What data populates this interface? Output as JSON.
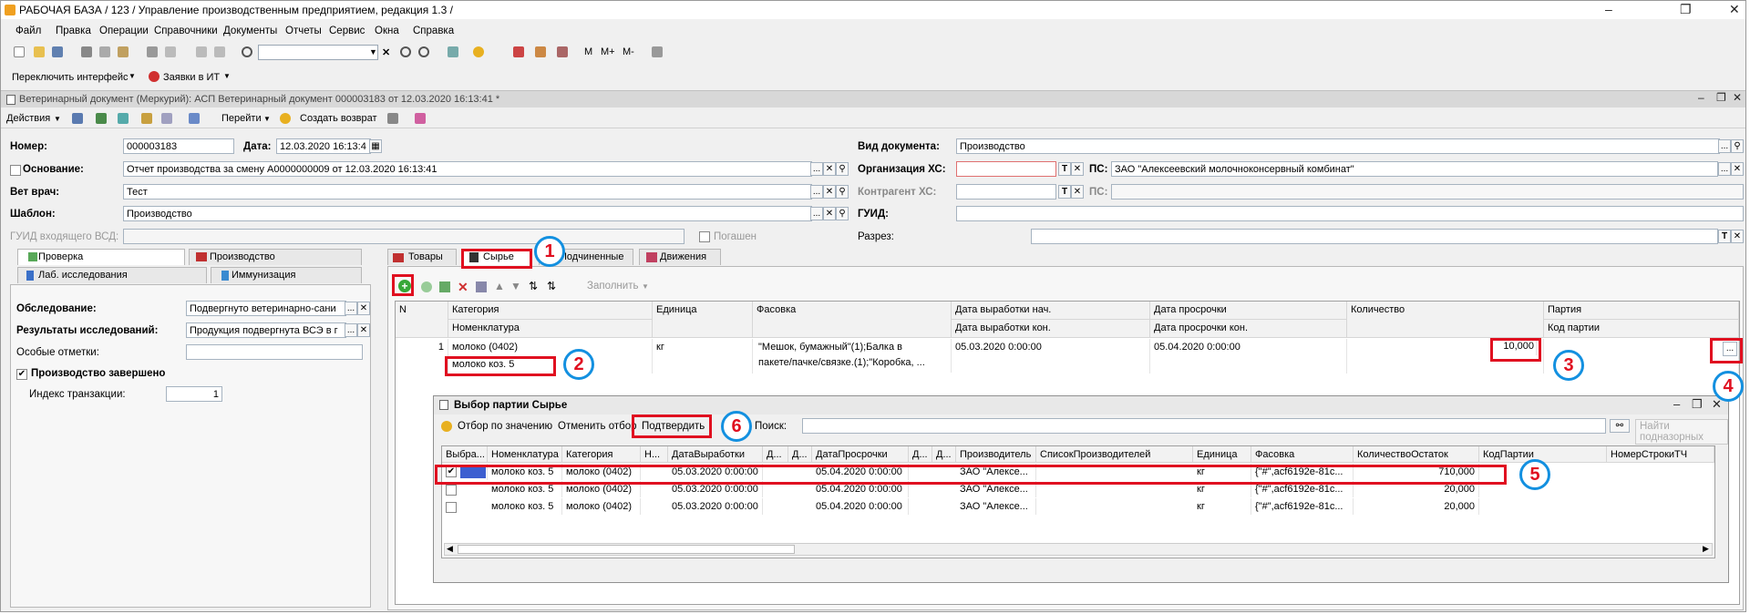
{
  "window": {
    "title": "РАБОЧАЯ БАЗА / 123 /  Управление производственным предприятием, редакция 1.3 /"
  },
  "menu": [
    "Файл",
    "Правка",
    "Операции",
    "Справочники",
    "Документы",
    "Отчеты",
    "Сервис",
    "Окна",
    "Справка"
  ],
  "toolbar2": {
    "switch": "Переключить интерфейс",
    "requests": "Заявки в ИТ"
  },
  "toolbar_letters": [
    "M",
    "M+",
    "M-"
  ],
  "doc": {
    "title": "Ветеринарный документ (Меркурий): АСП Ветеринарный документ 000003183 от 12.03.2020 16:13:41 *"
  },
  "actions": {
    "actions": "Действия",
    "goto": "Перейти",
    "return": "Создать возврат"
  },
  "form": {
    "number_label": "Номер:",
    "number": "000003183",
    "date_label": "Дата:",
    "date": "12.03.2020 16:13:4",
    "basis_label": "Основание:",
    "basis": "Отчет производства за смену А0000000009 от 12.03.2020 16:13:41",
    "vet_label": "Вет врач:",
    "vet": "Тест",
    "template_label": "Шаблон:",
    "template": "Производство",
    "guid_in_label": "ГУИД входящего ВСД:",
    "extinguished": "Погашен",
    "doc_type_label": "Вид документа:",
    "doc_type": "Производство",
    "org_label": "Организация ХС:",
    "ps_label": "ПС:",
    "ps": "ЗАО \"Алексеевский молочноконсервный комбинат\"",
    "contr_label": "Контрагент ХС:",
    "ps2_label": "ПС:",
    "guid_label": "ГУИД:",
    "section_label": "Разрез:"
  },
  "left_tabs": [
    "Проверка",
    "Производство",
    "Лаб. исследования",
    "Иммунизация"
  ],
  "left": {
    "exam_label": "Обследование:",
    "exam": "Подвергнуто ветеринарно-сани",
    "results_label": "Результаты исследований:",
    "results": "Продукция подвергнута ВСЭ в г",
    "notes_label": "Особые отметки:",
    "prod_done": "Производство завершено",
    "index_label": "Индекс транзакции:",
    "index": "1"
  },
  "right_tabs": [
    "Товары",
    "Сырье",
    "Подчиненные",
    "Движения"
  ],
  "raw": {
    "fill": "Заполнить",
    "headers": {
      "n": "N",
      "cat": "Категория",
      "nom": "Номенклатура",
      "unit": "Единица",
      "pack": "Фасовка",
      "dstart": "Дата выработки нач.",
      "dend": "Дата выработки кон.",
      "exp": "Дата просрочки",
      "exp_end": "Дата просрочки кон.",
      "qty": "Количество",
      "batch": "Партия",
      "batch_code": "Код партии"
    },
    "row": {
      "n": "1",
      "cat": "молоко (0402)",
      "nom": "молоко коз. 5",
      "unit": "кг",
      "pack1": "\"Мешок, бумажный\"(1);Балка в",
      "pack2": "пакете/пачке/связке.(1);\"Коробка, ...",
      "dstart": "05.03.2020 0:00:00",
      "exp": "05.04.2020 0:00:00",
      "qty": "10,000"
    }
  },
  "dialog": {
    "title": "Выбор партии Сырье",
    "filter": "Отбор по значению",
    "cancel": "Отменить отбор",
    "confirm": "Подтвердить",
    "search_label": "Поиск:",
    "find_sub": "Найти подназорных",
    "headers": [
      "Выбра...",
      "Номенклатура",
      "Категория",
      "Н...",
      "ДатаВыработки",
      "Д...",
      "Д...",
      "ДатаПросрочки",
      "Д...",
      "Д...",
      "Производитель",
      "СписокПроизводителей",
      "Единица",
      "Фасовка",
      "КоличествоОстаток",
      "КодПартии",
      "НомерСтрокиТЧ"
    ],
    "rows": [
      {
        "checked": true,
        "nom": "молоко коз. 5",
        "cat": "молоко (0402)",
        "d1": "05.03.2020 0:00:00",
        "d2": "05.04.2020 0:00:00",
        "prod": "ЗАО \"Алексе...",
        "unit": "кг",
        "pack": "{\"#\",acf6192e-81c...",
        "qty": "710,000"
      },
      {
        "checked": false,
        "nom": "молоко коз. 5",
        "cat": "молоко (0402)",
        "d1": "05.03.2020 0:00:00",
        "d2": "05.04.2020 0:00:00",
        "prod": "ЗАО \"Алексе...",
        "unit": "кг",
        "pack": "{\"#\",acf6192e-81c...",
        "qty": "20,000"
      },
      {
        "checked": false,
        "nom": "молоко коз. 5",
        "cat": "молоко (0402)",
        "d1": "05.03.2020 0:00:00",
        "d2": "05.04.2020 0:00:00",
        "prod": "ЗАО \"Алексе...",
        "unit": "кг",
        "pack": "{\"#\",acf6192e-81c...",
        "qty": "20,000"
      }
    ]
  },
  "badges": [
    "1",
    "2",
    "3",
    "4",
    "5",
    "6"
  ],
  "dots": "...",
  "colors": {
    "annotation_red": "#e01020",
    "annotation_blue": "#1390e0",
    "selected_row": "#3d5fd0"
  }
}
